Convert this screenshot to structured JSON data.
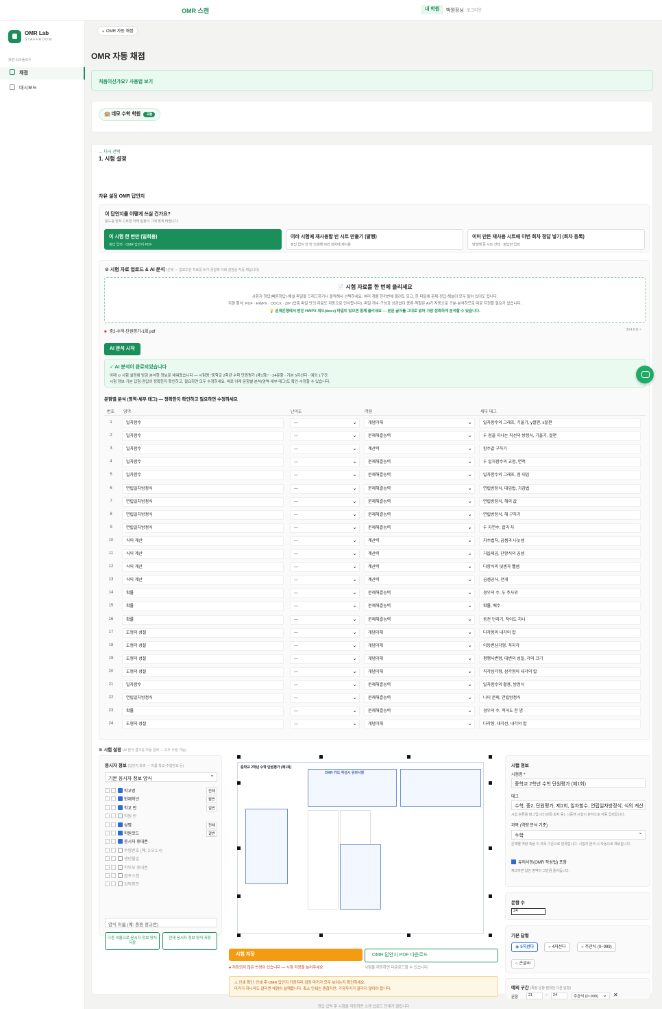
{
  "topbar": {
    "brand": "OMR 스캔",
    "mine": "내 학원",
    "user": "박원장님",
    "logout": "로그아웃"
  },
  "sidebar": {
    "title": "OMR Lab",
    "subtitle": "STAFFROOM",
    "section": "채점 워크플로우",
    "items": [
      {
        "label": "채점"
      },
      {
        "label": "대시보드"
      }
    ]
  },
  "main": {
    "crumb": "OMR 자동 채점",
    "title": "OMR 자동 채점",
    "banner": "처음이신가요? 사용법 보기",
    "academy": "데모 수학 학원",
    "academy_badge": "고등"
  },
  "step": {
    "back": "← 다시 선택",
    "title": "1. 시험 설정",
    "subtitle": "자유 설정 OMR 답안지",
    "q_title": "이 답안지를 어떻게 쓰실 건가요?",
    "q_sub": "용도를 먼저 고르면 아래 설정이 그에 맞게 바뀝니다.",
    "options": [
      {
        "title": "이 시험 한 번만 (일회용)",
        "desc": "정답 입력 · OMR 답안지 PDF"
      },
      {
        "title": "여러 시험에 재사용할 빈 시트 만들기 (발행)",
        "desc": "정답 없이 한 번 인쇄해 여러 회차에 재사용"
      },
      {
        "title": "이미 만든 재사용 시트에 이번 회차 정답 넣기 (회차 등록)",
        "desc": "발행해 둔 시트 선택 · 정답만 입력"
      }
    ]
  },
  "upload": {
    "title": "⊙ 시험 자료 업로드 & AI 분석",
    "title_note": "(선택 — 업로드한 자료를 AI가 종합해 아래 설정을 자동 채웁니다)",
    "drop_title": "📄 시험 자료를 한 번에 올리세요",
    "drop_l1": "시험지·정답(빠른정답)·해설 파일을 드래그하거나 클릭해서 선택하세요. 여러 개를 한꺼번에 올려도 되고, 한 파일에 문제·정답·해설이 모두 들어 있어도 됩니다.",
    "drop_l2": "지원 형식: PDF · HWPX · DOCX · ZIP (압축 파일 안의 자료도 자동으로 인식합니다). 파일 개수·구성과 상관없이 종류·역할은 AI가 자동으로 구분·분석하므로 따로 지정할 필요가 없습니다.",
    "drop_l3": "💡 문제은행에서 받은 HWPX·워드(docx) 파일이 있으면 함께 올리세요 — 본문 글자를 그대로 읽어 가장 정확하게 분석할 수 있습니다.",
    "file": "중2-수학-단원평가-1회.pdf",
    "file_size": "304 KB  ×",
    "ai_button": "AI 분석 시작",
    "done_title": "✓ AI 분석이 완료되었습니다",
    "done_l1": "아래 ⊙ 시험 설정에 방금 분석한 정보로 채워졌습니다 — 시험명 \"중학교 2학년 수학 단원평가 (제1회)\" · 24문항 · 기본 5지선다 · 예외 1구간.",
    "done_l2": "시험 정보·기본 답형·정답이 정확한지 확인하고, 필요하면 모두 수정하세요. 바로 아래 문항별 분석(영역·세부 태그)도 확인·수정할 수 있습니다."
  },
  "table": {
    "title": "문항별 분석 (영역·세부 태그) — 정확한지 확인하고 필요하면 수정하세요",
    "headers": [
      "번호",
      "영역",
      "난이도",
      "역량",
      "세부 태그"
    ],
    "rows": [
      [
        "1",
        "일차함수",
        "—",
        "개념이해",
        "일차함수의 그래프, 기울기, y절편, x절편"
      ],
      [
        "2",
        "일차함수",
        "—",
        "문제해결능력",
        "두 점을 지나는 직선의 방정식, 기울기, 절편"
      ],
      [
        "3",
        "일차함수",
        "—",
        "계산력",
        "함수값 구하기"
      ],
      [
        "4",
        "일차함수",
        "—",
        "문제해결능력",
        "두 일차함수의 교점, 면적"
      ],
      [
        "5",
        "일차함수",
        "—",
        "문제해결능력",
        "일차함수의 그래프, 점 대입"
      ],
      [
        "6",
        "연립일차방정식",
        "—",
        "문제해결능력",
        "연립방정식, 대입법, 가감법"
      ],
      [
        "7",
        "연립일차방정식",
        "—",
        "문제해결능력",
        "연립방정식, 해의 값"
      ],
      [
        "8",
        "연립일차방정식",
        "—",
        "문제해결능력",
        "연립방정식, 해 구하기"
      ],
      [
        "9",
        "연립일차방정식",
        "—",
        "문제해결능력",
        "두 자연수, 합과 차"
      ],
      [
        "10",
        "식의 계산",
        "—",
        "계산력",
        "지수법칙, 곱셈과 나눗셈"
      ],
      [
        "11",
        "식의 계산",
        "—",
        "계산력",
        "거듭제곱, 단항식의 곱셈"
      ],
      [
        "12",
        "식의 계산",
        "—",
        "계산력",
        "다항식의 덧셈과 뺄셈"
      ],
      [
        "13",
        "식의 계산",
        "—",
        "계산력",
        "곱셈공식, 전개"
      ],
      [
        "14",
        "확률",
        "—",
        "문제해결능력",
        "경우의 수, 두 주사위"
      ],
      [
        "15",
        "확률",
        "—",
        "문제해결능력",
        "확률, 배수"
      ],
      [
        "16",
        "확률",
        "—",
        "문제해결능력",
        "동전 던지기, 적어도 하나"
      ],
      [
        "17",
        "도형의 성질",
        "—",
        "개념이해",
        "다각형의 내각의 합"
      ],
      [
        "18",
        "도형의 성질",
        "—",
        "개념이해",
        "이등변삼각형, 꼭지각"
      ],
      [
        "19",
        "도형의 성질",
        "—",
        "개념이해",
        "평행사변형, 대변의 성질, 각의 크기"
      ],
      [
        "20",
        "도형의 성질",
        "—",
        "개념이해",
        "직각삼각형, 삼각형의 내각의 합"
      ],
      [
        "21",
        "일차함수",
        "—",
        "문제해결능력",
        "일차함수의 활용, 방정식"
      ],
      [
        "22",
        "연립일차방정식",
        "—",
        "문제해결능력",
        "나이 문제, 연립방정식"
      ],
      [
        "23",
        "확률",
        "—",
        "문제해결능력",
        "경우의 수, 적어도 한 명"
      ],
      [
        "24",
        "도형의 성질",
        "—",
        "개념이해",
        "다각형, 대각선, 내각의 합"
      ]
    ]
  },
  "settings": {
    "title": "⊙ 시험 설정",
    "title_note": "(AI 분석 결과를 자동 입력 — 모두 수정 가능)",
    "examinee_title": "응시자 정보",
    "examinee_note": "(답안지 좌측 — 이름·학교·수험번호 등)",
    "examinee_select": "기본 응시자 정보 양식",
    "fields": [
      {
        "label": "학교명",
        "on": true,
        "opt": "전체"
      },
      {
        "label": "현재학년",
        "on": true,
        "opt": "월반"
      },
      {
        "label": "학교 반",
        "on": true,
        "opt": "걸반"
      },
      {
        "label": "학원 반",
        "on": false,
        "opt": ""
      },
      {
        "label": "성명",
        "on": true,
        "opt": "전체"
      },
      {
        "label": "학원코드",
        "on": true,
        "opt": "걸반"
      },
      {
        "label": "응시자 휴대폰",
        "on": true,
        "opt": ""
      },
      {
        "label": "수험번호 (예: 2-3-1-4)",
        "on": false,
        "opt": ""
      },
      {
        "label": "생년월일",
        "on": false,
        "opt": ""
      },
      {
        "label": "학부모 휴대폰",
        "on": false,
        "opt": ""
      },
      {
        "label": "점프스캔",
        "on": false,
        "opt": ""
      },
      {
        "label": "감독확인",
        "on": false,
        "opt": ""
      }
    ],
    "form_name_placeholder": "양식 이름 (예: 중등 정규반)",
    "save_as": "다른 이름으로 응시자 정보 양식 저장",
    "overwrite": "현재 응시자 정보 양식 저장",
    "omr_header": "중학교 2학년 수학 단원평가 (제1회)",
    "omr_notice": "OMR 카드 작성시 유의사항",
    "save_button": "시험 저장",
    "pdf_button": "OMR 답안지 PDF 다운로드",
    "unsaved": "● 저장되지 않은 변경이 있습니다 — 시험 저장을 눌러주세요",
    "pdf_note": "시험을 저장하면 다운로드할 수 있습니다",
    "warn_l1": "⚠ 인쇄 확인: 인쇄 후 OMR 답안지 가장자리 검정 마커가 모두 보이는지 확인하세요.",
    "warn_l2": "마커가 하나라도 잘리면 채점이 실패합니다. 축소 인쇄는 괜찮지만, 가장자리가 잘리지 않아야 합니다.",
    "footer": "정답 입력 후 시험을 저장하면 스캔 업로드 단계가 열립니다"
  },
  "info": {
    "title": "시험 정보",
    "name_label": "시험명 *",
    "name": "중학교 2학년 수학 단원평가 (제1회)",
    "tag_label": "태그",
    "tags": "수학, 중2, 단원평가, 제1회, 일차함수, 연립일차방정식, 식의 계산",
    "tag_hint": "시험 분류용 태그입니다(과목·회차 등). 나중엔 시험이 분석으로 자동 입력됩니다.",
    "subject_label": "과목 (역량 분석 기준)",
    "subject": "수학",
    "subject_hint": "문제별 역량 축을 이 과목 기준으로 분류합니다. 시험지 분석 시 자동으로 채워집니다.",
    "essay_label": "유의사항(OMR 작성법) 포함",
    "essay_hint": "체크하면 답안 영역이 그만큼 줄어듭니다.",
    "count_title": "문항 수",
    "count": "24",
    "type_title": "기본 답형",
    "types": [
      "5지선다",
      "4지선다",
      "주관식 (0~999)",
      "손글씨"
    ],
    "exc_title": "예외 구간",
    "exc_note": "(특정 문항 범위만 다른 답형)",
    "exc_from": "21",
    "exc_to": "24",
    "exc_label": "문항",
    "exc_type": "주관식 (0~999)"
  },
  "colors": {
    "accent": "#1a8f5a",
    "warn": "#f39c12"
  }
}
